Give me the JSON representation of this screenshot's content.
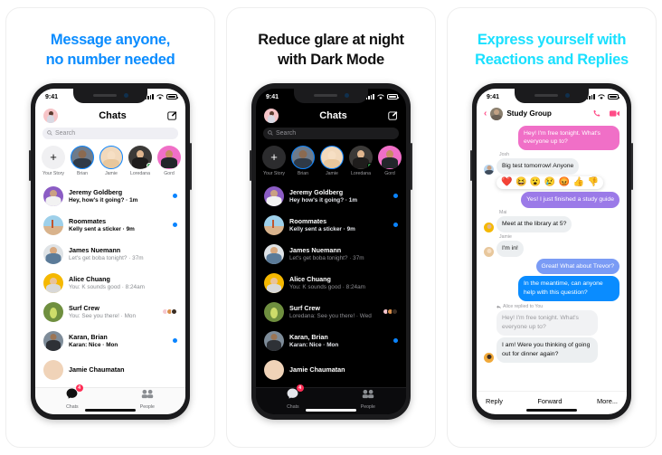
{
  "panels": [
    {
      "headline_line1": "Message anyone,",
      "headline_line2": "no number needed",
      "headline_color": "#0a8cff",
      "theme": "light"
    },
    {
      "headline_line1": "Reduce glare at night",
      "headline_line2": "with Dark Mode",
      "headline_color": "#101010",
      "theme": "dark"
    },
    {
      "headline_line1": "Express yourself with",
      "headline_line2": "Reactions and Replies",
      "headline_color": "#1ae0ff",
      "theme": "light"
    }
  ],
  "status_bar": {
    "time": "9:41"
  },
  "chats_screen": {
    "title": "Chats",
    "compose_icon": "compose-icon",
    "search_placeholder": "Search",
    "search_icon": "search-icon",
    "stories": [
      {
        "label": "Your Story",
        "add": true
      },
      {
        "label": "Brian",
        "active": true
      },
      {
        "label": "Jamie",
        "active": true
      },
      {
        "label": "Loredana",
        "online": true
      },
      {
        "label": "Gord"
      }
    ],
    "rows_light": [
      {
        "name": "Jeremy Goldberg",
        "preview": "Hey, how's it going? · 1m",
        "unread": true,
        "badge": "dot"
      },
      {
        "name": "Roommates",
        "preview": "Kelly sent a sticker · 9m",
        "unread": true,
        "badge": "dot"
      },
      {
        "name": "James Nuemann",
        "preview": "Let's get boba tonight? · 37m",
        "unread": false,
        "badge": "none"
      },
      {
        "name": "Alice Chuang",
        "preview": "You: K sounds good · 8:24am",
        "unread": false,
        "badge": "none"
      },
      {
        "name": "Surf Crew",
        "preview": "You: See you there! · Mon",
        "unread": false,
        "badge": "minis"
      },
      {
        "name": "Karan, Brian",
        "preview": "Karan: Nice · Mon",
        "unread": true,
        "badge": "dot"
      },
      {
        "name": "Jamie Chaumatan",
        "preview": "",
        "unread": false,
        "badge": "none"
      }
    ],
    "rows_dark": [
      {
        "name": "Jeremy Goldberg",
        "preview": "Hey how's it going? · 1m",
        "unread": true,
        "badge": "dot"
      },
      {
        "name": "Roommates",
        "preview": "Kelly sent a sticker · 9m",
        "unread": true,
        "badge": "dot"
      },
      {
        "name": "James Nuemann",
        "preview": "Let's get boba tonight? · 37m",
        "unread": false,
        "badge": "none"
      },
      {
        "name": "Alice Chuang",
        "preview": "You: K sounds good · 8:24am",
        "unread": false,
        "badge": "none"
      },
      {
        "name": "Surf Crew",
        "preview": "Loredana: See you there! · Wed",
        "unread": false,
        "badge": "minis"
      },
      {
        "name": "Karan, Brian",
        "preview": "Karan: Nice · Mon",
        "unread": true,
        "badge": "dot"
      },
      {
        "name": "Jamie Chaumatan",
        "preview": "",
        "unread": false,
        "badge": "none"
      }
    ],
    "tabs": [
      {
        "label": "Chats",
        "icon": "chat-bubble-icon",
        "badge": "4"
      },
      {
        "label": "People",
        "icon": "people-icon",
        "badge": ""
      }
    ]
  },
  "conversation_screen": {
    "back_icon": "back-chevron-icon",
    "title": "Study Group",
    "call_icon": "phone-icon",
    "video_icon": "video-camera-icon",
    "messages": [
      {
        "sender": "",
        "text": "Hey! I'm free tonight. What's everyone up to?",
        "side": "out",
        "style": "b-pink"
      },
      {
        "sender": "Josh",
        "text": "Big test tomorrow! Anyone",
        "side": "in",
        "style": "b-gray"
      },
      {
        "sender": "",
        "text": "Yes! I just finished a study guide",
        "side": "out",
        "style": "b-purple"
      },
      {
        "sender": "Mai",
        "text": "Meet at the library at 5?",
        "side": "in",
        "style": "b-gray"
      },
      {
        "sender": "Jamie",
        "text": "I'm in!",
        "side": "in",
        "style": "b-gray"
      },
      {
        "sender": "",
        "text": "Great! What about Trevor?",
        "side": "out",
        "style": "b-periwinkle"
      },
      {
        "sender": "",
        "text": "In the meantime, can anyone help with this question?",
        "side": "out",
        "style": "b-blue"
      },
      {
        "sender": "",
        "text": "Hey! I'm free tonight. What's everyone up to?",
        "side": "in",
        "style": "b-gray-muted",
        "quoted": true
      },
      {
        "sender": "",
        "text": "I am! Were you thinking of going out for dinner again?",
        "side": "in",
        "style": "b-gray"
      }
    ],
    "reply_tag": "Alice replied to You",
    "reactions": [
      "❤️",
      "😆",
      "😮",
      "😢",
      "😡",
      "👍",
      "👎"
    ],
    "actions": [
      "Reply",
      "Forward",
      "More..."
    ]
  }
}
